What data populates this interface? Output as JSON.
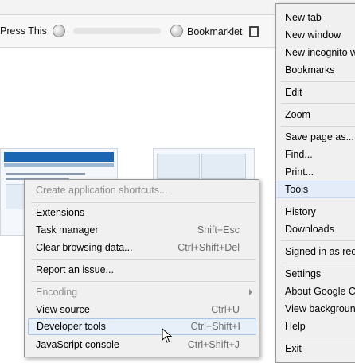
{
  "bookmarks_bar": {
    "items": [
      {
        "label": "Press This",
        "icon": "globe-icon"
      },
      {
        "label": "Bookmarklet",
        "icon": "globe-icon"
      }
    ]
  },
  "chrome_menu": {
    "items": [
      {
        "label": "New tab"
      },
      {
        "label": "New window"
      },
      {
        "label": "New incognito w"
      },
      {
        "label": "Bookmarks"
      },
      {
        "label": "Edit"
      },
      {
        "label": "Zoom"
      },
      {
        "label": "Save page as..."
      },
      {
        "label": "Find..."
      },
      {
        "label": "Print..."
      },
      {
        "label": "Tools"
      },
      {
        "label": "History"
      },
      {
        "label": "Downloads"
      },
      {
        "label": "Signed in as redc"
      },
      {
        "label": "Settings"
      },
      {
        "label": "About Google Ch"
      },
      {
        "label": "View backgroun"
      },
      {
        "label": "Help"
      },
      {
        "label": "Exit"
      }
    ]
  },
  "tools_submenu": {
    "items": [
      {
        "label": "Create application shortcuts...",
        "shortcut": ""
      },
      {
        "label": "Extensions",
        "shortcut": ""
      },
      {
        "label": "Task manager",
        "shortcut": "Shift+Esc"
      },
      {
        "label": "Clear browsing data...",
        "shortcut": "Ctrl+Shift+Del"
      },
      {
        "label": "Report an issue...",
        "shortcut": ""
      },
      {
        "label": "Encoding",
        "shortcut": ""
      },
      {
        "label": "View source",
        "shortcut": "Ctrl+U"
      },
      {
        "label": "Developer tools",
        "shortcut": "Ctrl+Shift+I"
      },
      {
        "label": "JavaScript console",
        "shortcut": "Ctrl+Shift+J"
      }
    ]
  },
  "colors": {
    "menu_bg": "#f0f0f0",
    "highlight_bg": "#e7eff9",
    "highlight_border": "#a9c6e8",
    "disabled_text": "#8d8d8d"
  }
}
